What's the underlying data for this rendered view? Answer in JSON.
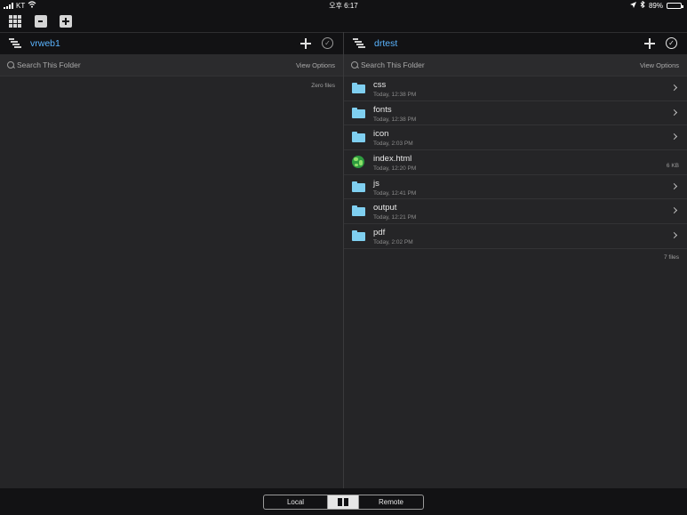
{
  "status_bar": {
    "carrier": "KT",
    "time": "오후 6:17",
    "battery": "89%",
    "battery_level": 0.89
  },
  "toolbar": {
    "icons": [
      "grid-icon",
      "minimize-window-icon",
      "new-window-icon"
    ]
  },
  "left_pane": {
    "folder": "vrweb1",
    "search_placeholder": "Search This Folder",
    "view_options": "View Options",
    "footer": "Zero files"
  },
  "right_pane": {
    "folder": "drtest",
    "search_placeholder": "Search This Folder",
    "view_options": "View Options",
    "footer": "7 files",
    "files": [
      {
        "name": "css",
        "date": "Today, 12:38 PM",
        "kind": "folder",
        "size": ""
      },
      {
        "name": "fonts",
        "date": "Today, 12:38 PM",
        "kind": "folder",
        "size": ""
      },
      {
        "name": "icon",
        "date": "Today, 2:03 PM",
        "kind": "folder",
        "size": ""
      },
      {
        "name": "index.html",
        "date": "Today, 12:20 PM",
        "kind": "html",
        "size": "6 KB"
      },
      {
        "name": "js",
        "date": "Today, 12:41 PM",
        "kind": "folder",
        "size": ""
      },
      {
        "name": "output",
        "date": "Today, 12:21 PM",
        "kind": "folder",
        "size": ""
      },
      {
        "name": "pdf",
        "date": "Today, 2:02 PM",
        "kind": "folder",
        "size": ""
      }
    ]
  },
  "bottom_bar": {
    "local_label": "Local",
    "remote_label": "Remote",
    "selected": "split"
  },
  "colors": {
    "accent": "#5ab4ff",
    "folder": "#7fcff0",
    "background": "#252527",
    "bar": "#121214"
  }
}
